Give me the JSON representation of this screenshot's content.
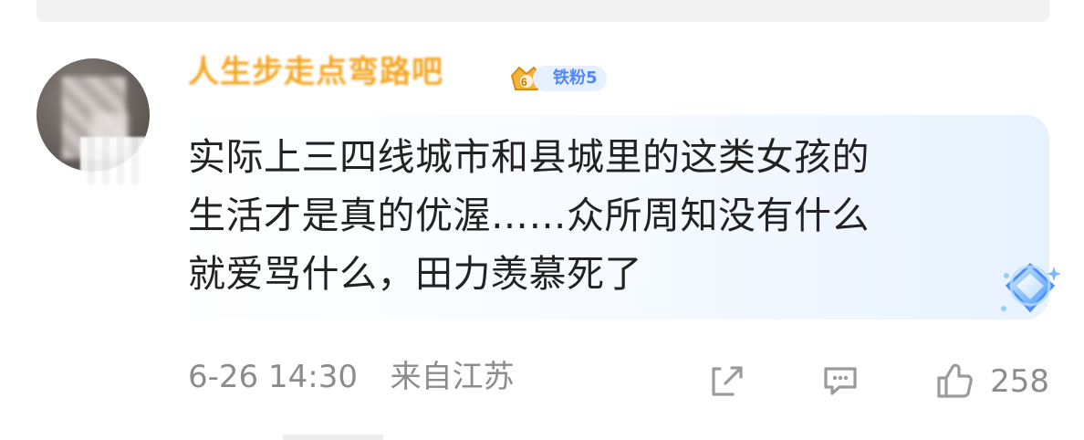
{
  "comment": {
    "username": "人生步走点弯路吧",
    "badge_level": "6",
    "fan_badge": "铁粉5",
    "text": "实际上三四线城市和县城里的这类女孩的\n生活才是真的优渥……众所周知没有什么\n就爱骂什么，田力羡慕死了",
    "date": "6-26 14:30",
    "location": "来自江苏",
    "like_count": "258"
  },
  "colors": {
    "username": "#f5a623",
    "badge_blue": "#4f87ff",
    "meta_gray": "#8c8c8c",
    "bubble_blue": "#e8f2ff"
  },
  "icons": {
    "share": "share-icon",
    "comment": "comment-icon",
    "like": "like-icon",
    "crown": "crown-badge-icon",
    "deco": "diamond-bubble-icon"
  }
}
